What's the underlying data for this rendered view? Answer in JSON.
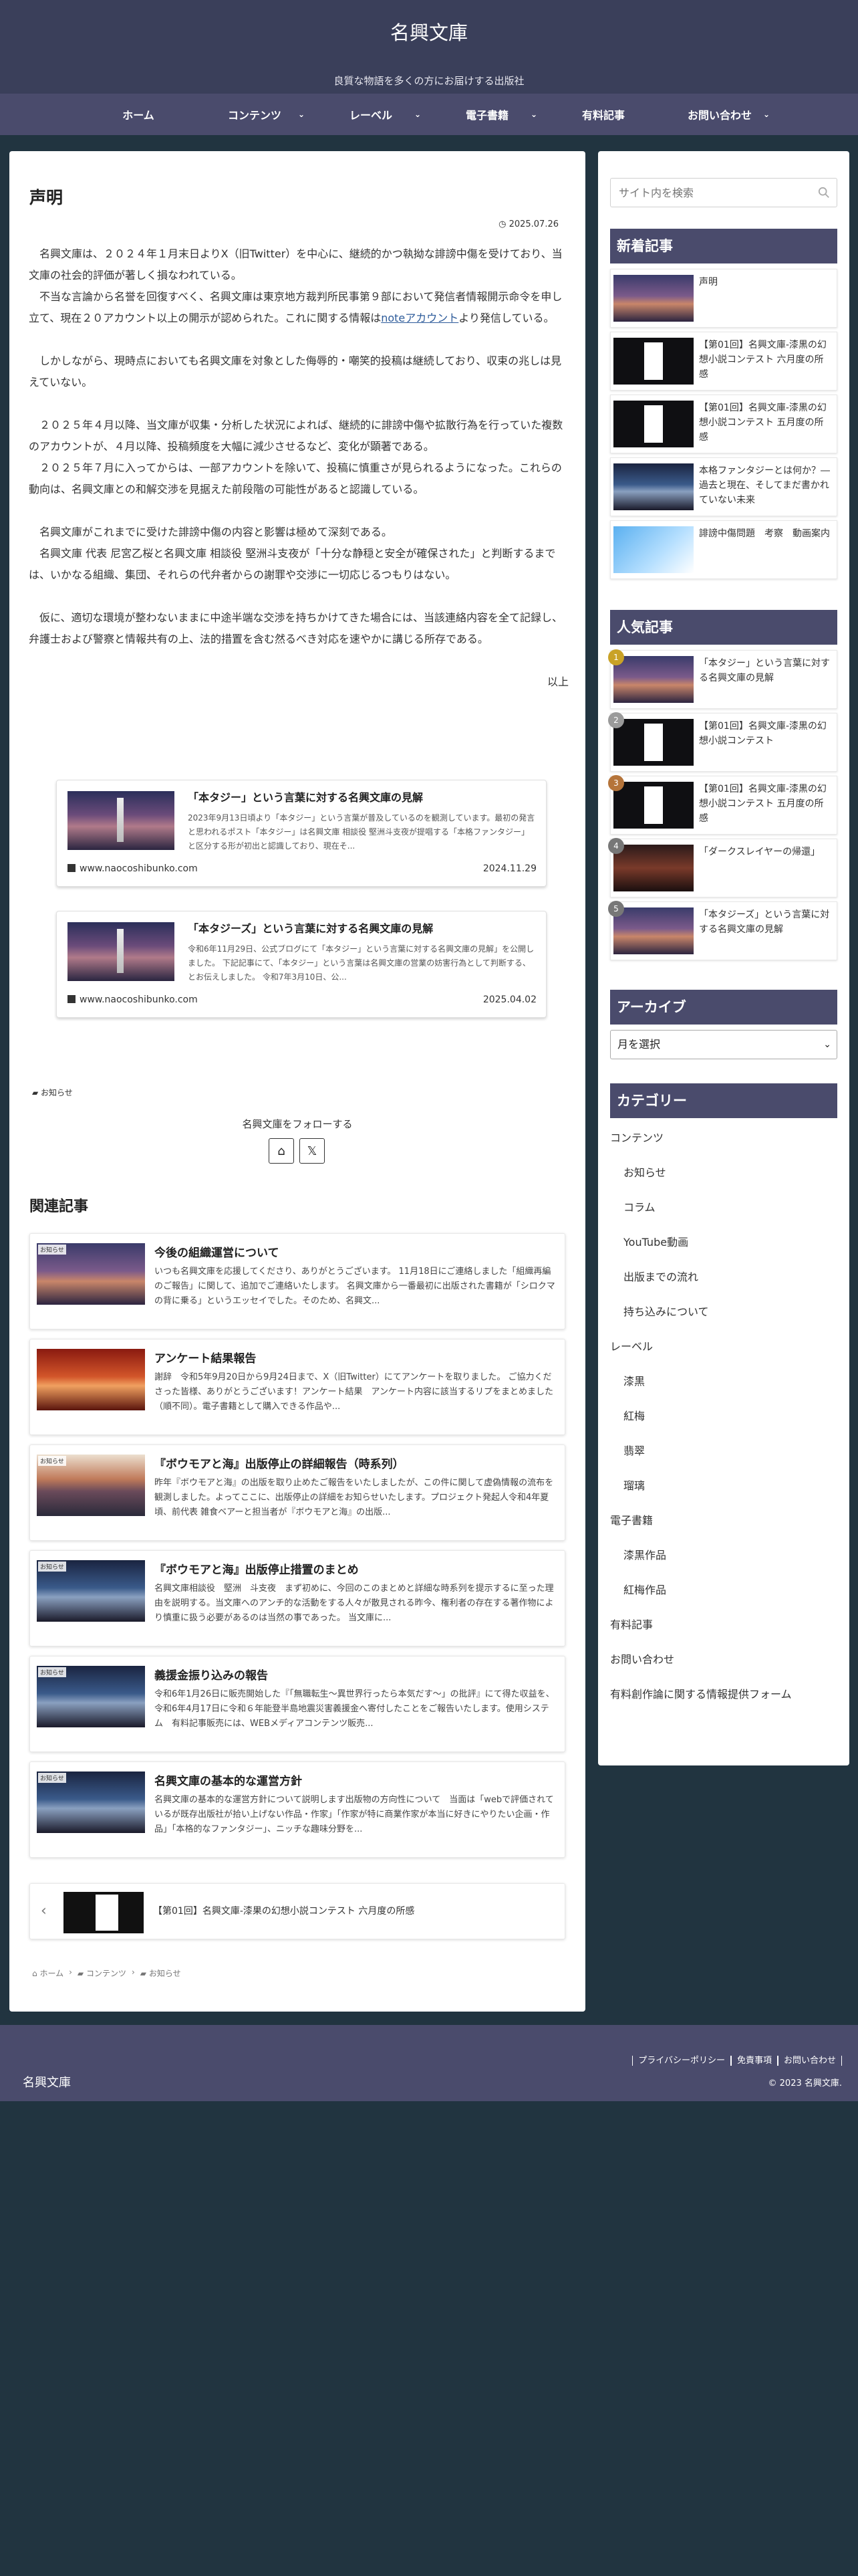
{
  "site": {
    "title": "名興文庫",
    "tagline": "良質な物語を多くの方にお届けする出版社"
  },
  "nav": [
    {
      "label": "ホーム",
      "has_submenu": false
    },
    {
      "label": "コンテンツ",
      "has_submenu": true
    },
    {
      "label": "レーベル",
      "has_submenu": true
    },
    {
      "label": "電子書籍",
      "has_submenu": true
    },
    {
      "label": "有料記事",
      "has_submenu": false
    },
    {
      "label": "お問い合わせ",
      "has_submenu": true
    }
  ],
  "article": {
    "title": "声明",
    "date": "2025.07.26",
    "paragraphs": [
      "　名興文庫は、２０２４年１月末日よりX（旧Twitter）を中心に、継続的かつ執拗な誹謗中傷を受けており、当文庫の社会的評価が著しく損なわれている。",
      "　不当な言論から名誉を回復すべく、名興文庫は東京地方裁判所民事第９部において発信者情報開示命令を申し立て、現在２０アカウント以上の開示が認められた。これに関する情報は",
      "より発信している。",
      "　しかしながら、現時点においても名興文庫を対象とした侮辱的・嘲笑的投稿は継続しており、収束の兆しは見えていない。",
      "　２０２５年４月以降、当文庫が収集・分析した状況によれば、継続的に誹謗中傷や拡散行為を行っていた複数のアカウントが、４月以降、投稿頻度を大幅に減少させるなど、変化が顕著である。",
      "　２０２５年７月に入ってからは、一部アカウントを除いて、投稿に慎重さが見られるようになった。これらの動向は、名興文庫との和解交渉を見据えた前段階の可能性があると認識している。",
      "　名興文庫がこれまでに受けた誹謗中傷の内容と影響は極めて深刻である。",
      "　名興文庫 代表 尼宮乙桜と名興文庫 相談役 堅洲斗支夜が「十分な静穏と安全が確保された」と判断するまでは、いかなる組織、集団、それらの代弁者からの謝罪や交渉に一切応じるつもりはない。",
      "　仮に、適切な環境が整わないままに中途半端な交渉を持ちかけてきた場合には、当該連絡内容を全て記録し、弁護士および警察と情報共有の上、法的措置を含む然るべき対応を速やかに講じる所存である。"
    ],
    "note_link": "noteアカウント",
    "closing": "以上"
  },
  "blogcards": [
    {
      "title": "「本タジー」という言葉に対する名興文庫の見解",
      "snippet": "2023年9月13日頃より「本タジー」という言葉が普及しているのを観測しています。最初の発言と思われるポスト「本タジー」は名興文庫 相談役 堅洲斗支夜が提唱する「本格ファンタジー」と区分する形が初出と認識しており、現在そ...",
      "site": "www.naocoshibunko.com",
      "date": "2024.11.29"
    },
    {
      "title": "「本タジーズ」という言葉に対する名興文庫の見解",
      "snippet": "令和6年11月29日、公式ブログにて「本タジー」という言葉に対する名興文庫の見解」を公開しました。 下記記事にて、「本タジー」という言葉は名興文庫の営業の妨害行為として判断する、とお伝えしました。 令和7年3月10日、公...",
      "site": "www.naocoshibunko.com",
      "date": "2025.04.02"
    }
  ],
  "category_label": "お知らせ",
  "follow": {
    "title": "名興文庫をフォローする",
    "buttons": [
      "home-icon",
      "x-icon"
    ]
  },
  "related": {
    "title": "関連記事",
    "badge": "お知らせ",
    "items": [
      {
        "title": "今後の組織運営について",
        "snippet": "いつも名興文庫を応援してくださり、ありがとうございます。 11月18日にご連絡しました「組織再編のご報告」に関して、追加でご連絡いたします。 名興文庫から一番最初に出版された書籍が「シロクマの背に乗る」というエッセイでした。そのため、名興文...",
        "thumb": "t-dusk"
      },
      {
        "title": "アンケート結果報告",
        "snippet": "謝辞　令和5年9月20日から9月24日まで、X（旧Twitter）にてアンケートを取りました。 ご協力くださった皆様、ありがとうございます！アンケート結果　アンケート内容に該当するリプをまとめました（順不同）。電子書籍として購入できる作品や...",
        "thumb": "t-red"
      },
      {
        "title": "『ボウモアと海』出版停止の詳細報告（時系列）",
        "snippet": "昨年『ボウモアと海』の出版を取り止めたご報告をいたしましたが、この件に関して虚偽情報の流布を観測しました。よってここに、出版停止の詳細をお知らせいたします。プロジェクト発起人令和4年夏頃、前代表 雑食ベアーと担当者が『ボウモアと海』の出版...",
        "thumb": "t-sea"
      },
      {
        "title": "『ボウモアと海』出版停止措置のまとめ",
        "snippet": "名興文庫相談役　堅洲　斗支夜　まず初めに、今回のこのまとめと詳細な時系列を提示するに至った理由を説明する。当文庫へのアンチ的な活動をする人々が散見される昨今、権利者の存在する著作物により慎重に扱う必要があるのは当然の事であった。 当文庫に...",
        "thumb": "t-blue"
      },
      {
        "title": "義援金振り込みの報告",
        "snippet": "令和6年1月26日に販売開始した『「無職転生〜異世界行ったら本気だす〜」の批評』にて得た収益を、令和6年4月17日に令和６年能登半島地震災害義援金へ寄付したことをご報告いたします。使用システム　有料記事販売には、WEBメディアコンテンツ販売...",
        "thumb": "t-blue"
      },
      {
        "title": "名興文庫の基本的な運営方針",
        "snippet": "名興文庫の基本的な運営方針について説明します出版物の方向性について　当面は「webで評価されているが既存出版社が拾い上げない作品・作家」「作家が特に商業作家が本当に好きにやりたい企画・作品」「本格的なファンタジー」、ニッチな趣味分野を...",
        "thumb": "t-blue"
      }
    ]
  },
  "prev_post": {
    "label": "【第01回】名興文庫-漆果の幻想小説コンテスト 六月度の所感"
  },
  "breadcrumb": [
    "ホーム",
    "コンテンツ",
    "お知らせ"
  ],
  "sidebar": {
    "search_placeholder": "サイト内を検索",
    "new_posts_title": "新着記事",
    "new_posts": [
      {
        "title": "声明",
        "thumb": "t-dusk"
      },
      {
        "title": "【第01回】名興文庫-漆黒の幻想小説コンテスト 六月度の所感",
        "thumb": "t-book"
      },
      {
        "title": "【第01回】名興文庫-漆黒の幻想小説コンテスト 五月度の所感",
        "thumb": "t-book"
      },
      {
        "title": "本格ファンタジーとは何か？―過去と現在、そしてまだ書かれていない未来",
        "thumb": "t-blue"
      },
      {
        "title": "誹謗中傷問題　考察　動画案内",
        "thumb": "t-yt"
      }
    ],
    "popular_title": "人気記事",
    "popular_posts": [
      {
        "rank": "1",
        "title": "「本タジー」という言葉に対する名興文庫の見解",
        "thumb": "t-dusk",
        "color": "#c9a227"
      },
      {
        "rank": "2",
        "title": "【第01回】名興文庫-漆黒の幻想小説コンテスト",
        "thumb": "t-book",
        "color": "#9a9a9a"
      },
      {
        "rank": "3",
        "title": "【第01回】名興文庫-漆黒の幻想小説コンテスト 五月度の所感",
        "thumb": "t-book",
        "color": "#b5743a"
      },
      {
        "rank": "4",
        "title": "「ダークスレイヤーの帰還」",
        "thumb": "t-dark",
        "color": "#777777"
      },
      {
        "rank": "5",
        "title": "「本タジーズ」という言葉に対する名興文庫の見解",
        "thumb": "t-dusk",
        "color": "#777777"
      }
    ],
    "archive_title": "アーカイブ",
    "archive_select": "月を選択",
    "category_title": "カテゴリー",
    "categories": [
      {
        "label": "コンテンツ",
        "child": false
      },
      {
        "label": "お知らせ",
        "child": true
      },
      {
        "label": "コラム",
        "child": true
      },
      {
        "label": "YouTube動画",
        "child": true
      },
      {
        "label": "出版までの流れ",
        "child": true
      },
      {
        "label": "持ち込みについて",
        "child": true
      },
      {
        "label": "レーベル",
        "child": false
      },
      {
        "label": "漆黒",
        "child": true
      },
      {
        "label": "紅梅",
        "child": true
      },
      {
        "label": "翡翠",
        "child": true
      },
      {
        "label": "瑠璃",
        "child": true
      },
      {
        "label": "電子書籍",
        "child": false
      },
      {
        "label": "漆黒作品",
        "child": true
      },
      {
        "label": "紅梅作品",
        "child": true
      },
      {
        "label": "有料記事",
        "child": false
      },
      {
        "label": "お問い合わせ",
        "child": false
      },
      {
        "label": "有料創作論に関する情報提供フォーム",
        "child": false
      }
    ]
  },
  "footer": {
    "site_name": "名興文庫",
    "links": [
      "プライバシーポリシー",
      "免責事項",
      "お問い合わせ"
    ],
    "copyright": "© 2023 名興文庫."
  }
}
